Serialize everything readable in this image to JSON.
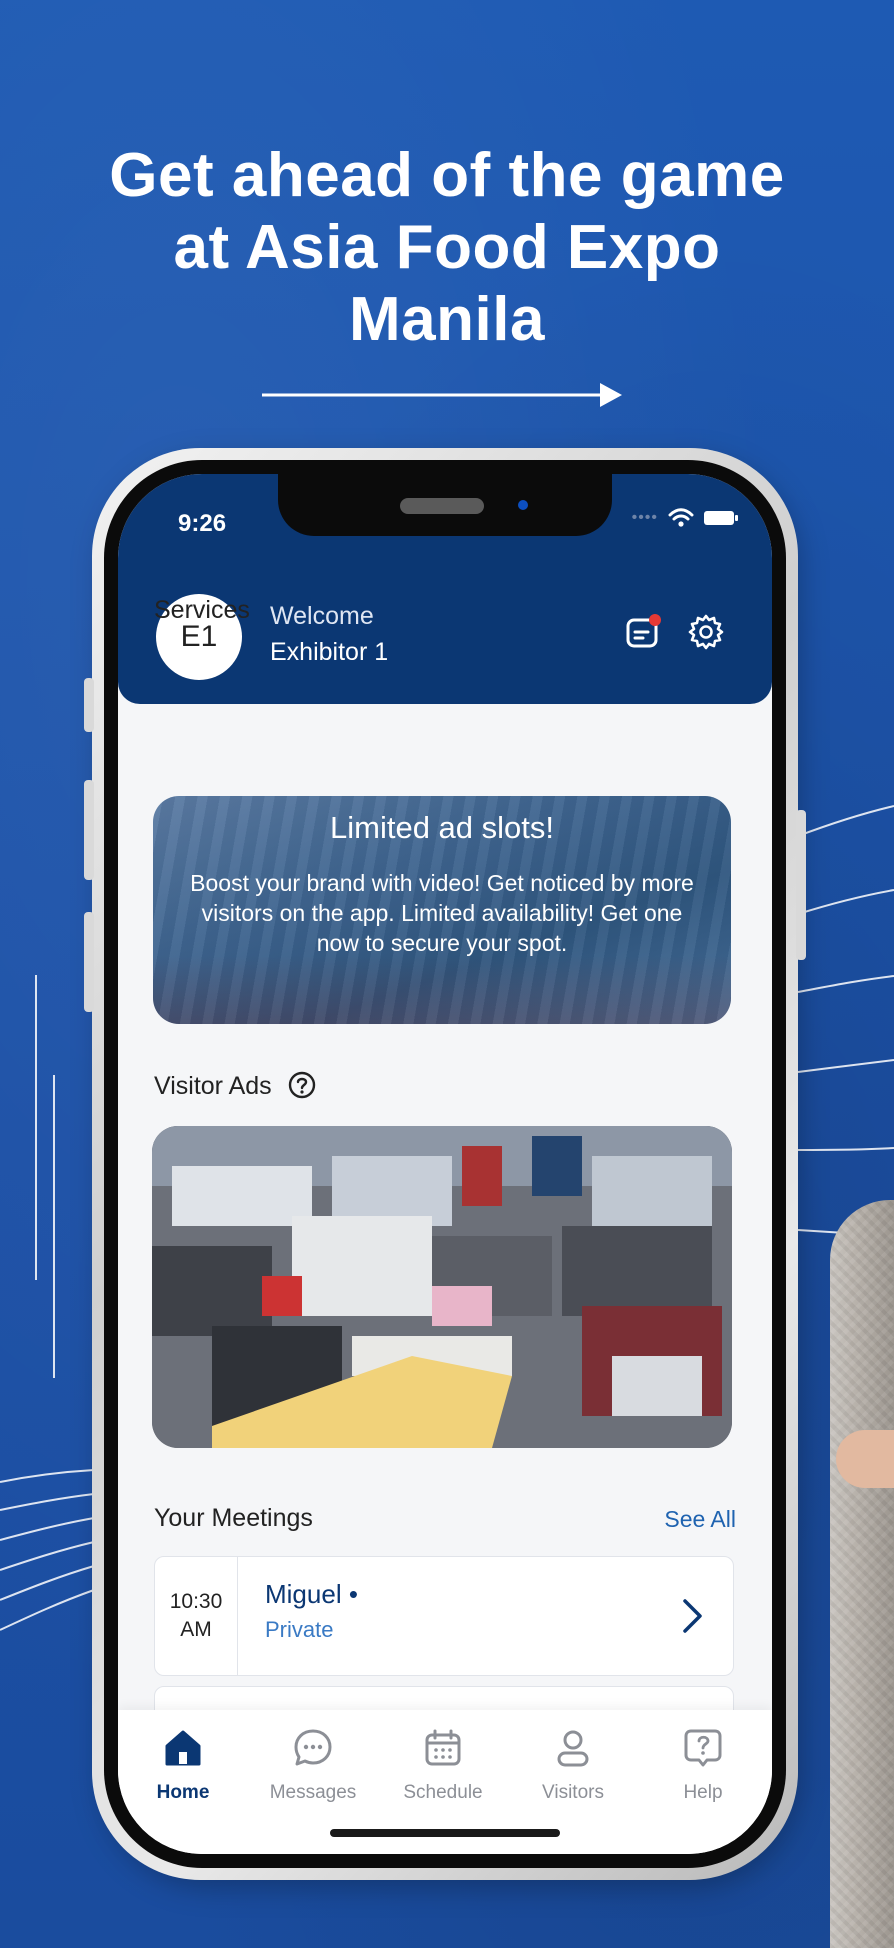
{
  "promo": {
    "headline_line1": "Get ahead of the game",
    "headline_line2": "at Asia Food Expo",
    "headline_line3": "Manila"
  },
  "status_bar": {
    "time": "9:26"
  },
  "header": {
    "avatar_initials": "E1",
    "welcome_label": "Welcome",
    "user_name": "Exhibitor 1"
  },
  "services": {
    "title": "Services",
    "ad_title": "Limited ad slots!",
    "ad_body": "Boost your brand with video! Get noticed by more visitors on the app. Limited availability! Get one now to secure your spot."
  },
  "visitor_ads": {
    "title": "Visitor Ads"
  },
  "meetings": {
    "title": "Your Meetings",
    "see_all_label": "See All",
    "items": [
      {
        "time_line1": "10:30",
        "time_line2": "AM",
        "name": "Miguel •",
        "type": "Private"
      }
    ]
  },
  "tabs": [
    {
      "label": "Home",
      "icon": "home-icon",
      "active": true
    },
    {
      "label": "Messages",
      "icon": "chat-bubble-icon",
      "active": false
    },
    {
      "label": "Schedule",
      "icon": "calendar-icon",
      "active": false
    },
    {
      "label": "Visitors",
      "icon": "person-icon",
      "active": false
    },
    {
      "label": "Help",
      "icon": "help-icon",
      "active": false
    }
  ],
  "colors": {
    "background": "#1f56ad",
    "header": "#0b3773",
    "accent": "#1f63b0",
    "notification": "#e53935"
  }
}
